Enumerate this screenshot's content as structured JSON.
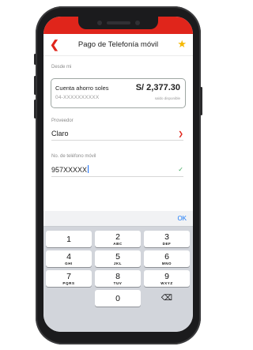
{
  "header": {
    "back_icon": "chevron-left-icon",
    "title": "Pago de Telefonía móvil",
    "favorite_icon": "star-icon"
  },
  "source": {
    "label": "Desde mi",
    "account_name": "Cuenta ahorro soles",
    "account_number": "04-XXXXXXXXXX",
    "balance": "S/ 2,377.30",
    "balance_caption": "saldo disponible"
  },
  "provider": {
    "label": "Proveedor",
    "value": "Claro"
  },
  "phone": {
    "label": "No. de teléfono móvil",
    "value": "957XXXXX"
  },
  "keyboard": {
    "ok_label": "OK",
    "keys": [
      {
        "digit": "1",
        "letters": ""
      },
      {
        "digit": "2",
        "letters": "ABC"
      },
      {
        "digit": "3",
        "letters": "DEF"
      },
      {
        "digit": "4",
        "letters": "GHI"
      },
      {
        "digit": "5",
        "letters": "JKL"
      },
      {
        "digit": "6",
        "letters": "MNO"
      },
      {
        "digit": "7",
        "letters": "PQRS"
      },
      {
        "digit": "8",
        "letters": "TUV"
      },
      {
        "digit": "9",
        "letters": "WXYZ"
      },
      {
        "digit": "0",
        "letters": ""
      }
    ],
    "delete_icon": "backspace-icon"
  },
  "colors": {
    "brand": "#e0251b",
    "check": "#3aa65a",
    "accent": "#1a7af8",
    "star": "#f5b800"
  }
}
